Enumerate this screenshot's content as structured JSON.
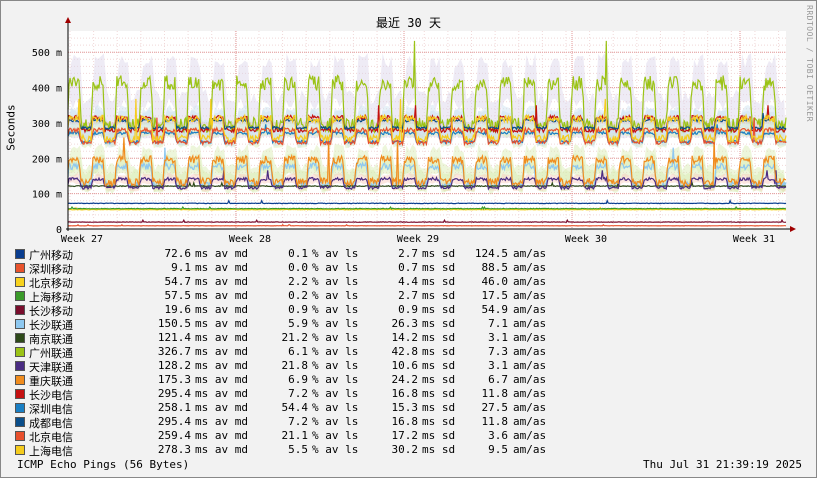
{
  "title": "最近 30 天",
  "ylabel": "Seconds",
  "watermark": "RRDTOOL / TOBI OETIKER",
  "footer_left": "ICMP Echo Pings (56 Bytes)",
  "footer_right": "Thu Jul 31 21:39:19 2025",
  "chart_data": {
    "type": "line",
    "title": "最近 30 天",
    "ylabel": "Seconds",
    "ylim": [
      0,
      560
    ],
    "y_unit": "m",
    "y_ticks": [
      {
        "v": 0,
        "label": "0"
      },
      {
        "v": 100,
        "label": "100 m"
      },
      {
        "v": 200,
        "label": "200 m"
      },
      {
        "v": 300,
        "label": "300 m"
      },
      {
        "v": 400,
        "label": "400 m"
      },
      {
        "v": 500,
        "label": "500 m"
      }
    ],
    "x_ticks": [
      "Week 27",
      "Week 28",
      "Week 29",
      "Week 30",
      "Week 31"
    ],
    "grid": true,
    "series": [
      {
        "name": "广州移动",
        "color": "#0a3d8f",
        "avg": 72.6,
        "min": 72.0,
        "max": 80,
        "style": "flat"
      },
      {
        "name": "深圳移动",
        "color": "#e8532d",
        "avg": 9.1,
        "min": 8.5,
        "max": 12,
        "style": "flat"
      },
      {
        "name": "北京移动",
        "color": "#f7d21e",
        "avg": 54.7,
        "min": 52,
        "max": 60,
        "style": "flat"
      },
      {
        "name": "上海移动",
        "color": "#3a9a2a",
        "avg": 57.5,
        "min": 55,
        "max": 62,
        "style": "flat"
      },
      {
        "name": "长沙移动",
        "color": "#7a0d2d",
        "avg": 19.6,
        "min": 18.5,
        "max": 25,
        "style": "flat"
      },
      {
        "name": "长沙联通",
        "color": "#8ec8f0",
        "avg": 150.5,
        "min": 110,
        "max": 185,
        "style": "diurnal"
      },
      {
        "name": "南京联通",
        "color": "#2e4a1a",
        "avg": 121.4,
        "min": 118,
        "max": 130,
        "style": "flat"
      },
      {
        "name": "广州联通",
        "color": "#9bc316",
        "avg": 326.7,
        "min": 260,
        "max": 430,
        "style": "diurnal"
      },
      {
        "name": "天津联通",
        "color": "#4a2c82",
        "avg": 128.2,
        "min": 110,
        "max": 145,
        "style": "diurnal"
      },
      {
        "name": "重庆联通",
        "color": "#f08c1e",
        "avg": 175.3,
        "min": 115,
        "max": 205,
        "style": "diurnal"
      },
      {
        "name": "长沙电信",
        "color": "#c41010",
        "avg": 295.4,
        "min": 270,
        "max": 320,
        "style": "diurnal"
      },
      {
        "name": "深圳电信",
        "color": "#1a7fc4",
        "avg": 258.1,
        "min": 240,
        "max": 275,
        "style": "diurnal"
      },
      {
        "name": "成都电信",
        "color": "#0b4e8a",
        "avg": 295.4,
        "min": 280,
        "max": 310,
        "style": "diurnal"
      },
      {
        "name": "北京电信",
        "color": "#e8502d",
        "avg": 259.4,
        "min": 235,
        "max": 285,
        "style": "diurnal"
      },
      {
        "name": "上海电信",
        "color": "#f5cc1e",
        "avg": 278.3,
        "min": 240,
        "max": 320,
        "style": "diurnal"
      }
    ]
  },
  "legend": [
    {
      "name": "广州移动",
      "color": "#0a3d8f",
      "avg": "72.6",
      "avg_unit": "ms av md",
      "loss": "0.1",
      "loss_unit": "% av ls",
      "sd": "2.7",
      "sd_unit": "ms sd",
      "amas": "124.5",
      "amas_unit": "am/as"
    },
    {
      "name": "深圳移动",
      "color": "#e8532d",
      "avg": "9.1",
      "avg_unit": "ms av md",
      "loss": "0.0",
      "loss_unit": "% av ls",
      "sd": "0.7",
      "sd_unit": "ms sd",
      "amas": "88.5",
      "amas_unit": "am/as"
    },
    {
      "name": "北京移动",
      "color": "#f7d21e",
      "avg": "54.7",
      "avg_unit": "ms av md",
      "loss": "2.2",
      "loss_unit": "% av ls",
      "sd": "4.4",
      "sd_unit": "ms sd",
      "amas": "46.0",
      "amas_unit": "am/as"
    },
    {
      "name": "上海移动",
      "color": "#3a9a2a",
      "avg": "57.5",
      "avg_unit": "ms av md",
      "loss": "0.2",
      "loss_unit": "% av ls",
      "sd": "2.7",
      "sd_unit": "ms sd",
      "amas": "17.5",
      "amas_unit": "am/as"
    },
    {
      "name": "长沙移动",
      "color": "#7a0d2d",
      "avg": "19.6",
      "avg_unit": "ms av md",
      "loss": "0.9",
      "loss_unit": "% av ls",
      "sd": "0.9",
      "sd_unit": "ms sd",
      "amas": "54.9",
      "amas_unit": "am/as"
    },
    {
      "name": "长沙联通",
      "color": "#8ec8f0",
      "avg": "150.5",
      "avg_unit": "ms av md",
      "loss": "5.9",
      "loss_unit": "% av ls",
      "sd": "26.3",
      "sd_unit": "ms sd",
      "amas": "7.1",
      "amas_unit": "am/as"
    },
    {
      "name": "南京联通",
      "color": "#2e4a1a",
      "avg": "121.4",
      "avg_unit": "ms av md",
      "loss": "21.2",
      "loss_unit": "% av ls",
      "sd": "14.2",
      "sd_unit": "ms sd",
      "amas": "3.1",
      "amas_unit": "am/as"
    },
    {
      "name": "广州联通",
      "color": "#9bc316",
      "avg": "326.7",
      "avg_unit": "ms av md",
      "loss": "6.1",
      "loss_unit": "% av ls",
      "sd": "42.8",
      "sd_unit": "ms sd",
      "amas": "7.3",
      "amas_unit": "am/as"
    },
    {
      "name": "天津联通",
      "color": "#4a2c82",
      "avg": "128.2",
      "avg_unit": "ms av md",
      "loss": "21.8",
      "loss_unit": "% av ls",
      "sd": "10.6",
      "sd_unit": "ms sd",
      "amas": "3.1",
      "amas_unit": "am/as"
    },
    {
      "name": "重庆联通",
      "color": "#f08c1e",
      "avg": "175.3",
      "avg_unit": "ms av md",
      "loss": "6.9",
      "loss_unit": "% av ls",
      "sd": "24.2",
      "sd_unit": "ms sd",
      "amas": "6.7",
      "amas_unit": "am/as"
    },
    {
      "name": "长沙电信",
      "color": "#c41010",
      "avg": "295.4",
      "avg_unit": "ms av md",
      "loss": "7.2",
      "loss_unit": "% av ls",
      "sd": "16.8",
      "sd_unit": "ms sd",
      "amas": "11.8",
      "amas_unit": "am/as"
    },
    {
      "name": "深圳电信",
      "color": "#1a7fc4",
      "avg": "258.1",
      "avg_unit": "ms av md",
      "loss": "54.4",
      "loss_unit": "% av ls",
      "sd": "15.3",
      "sd_unit": "ms sd",
      "amas": "27.5",
      "amas_unit": "am/as"
    },
    {
      "name": "成都电信",
      "color": "#0b4e8a",
      "avg": "295.4",
      "avg_unit": "ms av md",
      "loss": "7.2",
      "loss_unit": "% av ls",
      "sd": "16.8",
      "sd_unit": "ms sd",
      "amas": "11.8",
      "amas_unit": "am/as"
    },
    {
      "name": "北京电信",
      "color": "#e8502d",
      "avg": "259.4",
      "avg_unit": "ms av md",
      "loss": "21.1",
      "loss_unit": "% av ls",
      "sd": "17.2",
      "sd_unit": "ms sd",
      "amas": "3.6",
      "amas_unit": "am/as"
    },
    {
      "name": "上海电信",
      "color": "#f5cc1e",
      "avg": "278.3",
      "avg_unit": "ms av md",
      "loss": "5.5",
      "loss_unit": "% av ls",
      "sd": "30.2",
      "sd_unit": "ms sd",
      "amas": "9.5",
      "amas_unit": "am/as"
    }
  ]
}
